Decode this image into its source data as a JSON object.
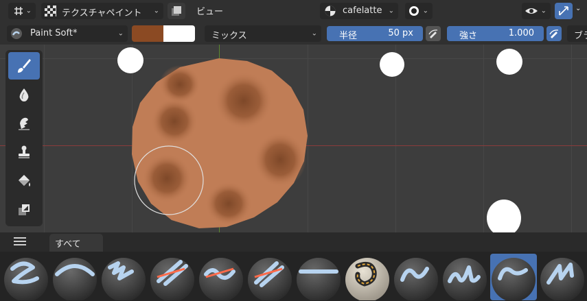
{
  "header": {
    "editor_type": "テクスチャペイント",
    "view_menu": "ビュー",
    "material_name": "cafelatte"
  },
  "tool_settings": {
    "brush_name": "Paint Soft*",
    "brush_color": "#8b4a23",
    "secondary_color": "#ffffff",
    "blend_mode": "ミックス",
    "radius_label": "半径",
    "radius_value": "50 px",
    "strength_label": "強さ",
    "strength_value": "1.000",
    "overflow_label": "ブラ"
  },
  "shelf": {
    "tab_label": "すべて"
  },
  "tools": [
    "paint-brush",
    "blur",
    "smear",
    "clone",
    "fill",
    "mask"
  ],
  "colors": {
    "accent": "#4772b3",
    "object_fill": "#c07d56"
  }
}
